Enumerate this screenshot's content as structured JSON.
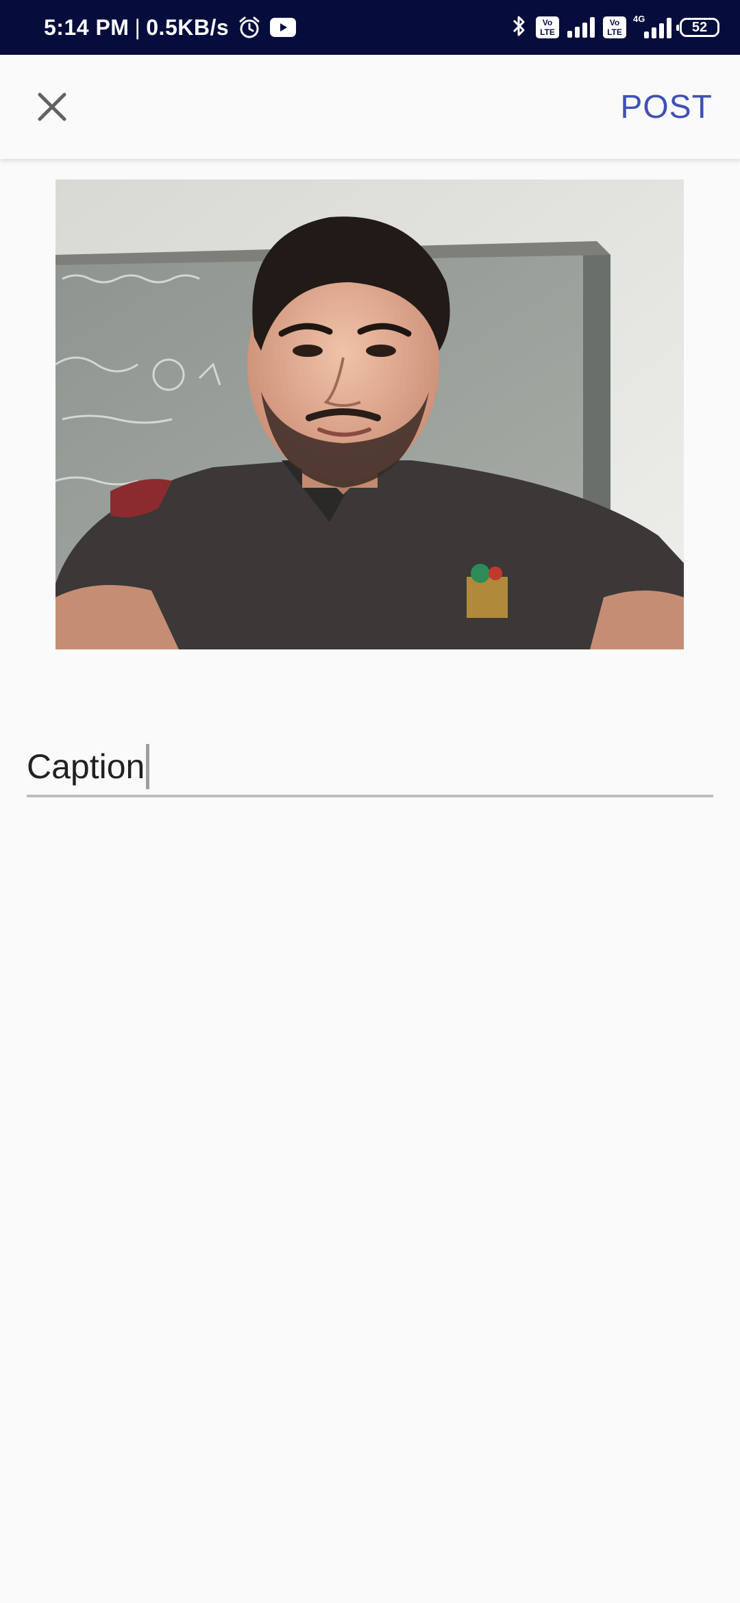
{
  "status_bar": {
    "time": "5:14 PM",
    "separator": "|",
    "net_speed": "0.5KB/s",
    "alarm_icon": "alarm-icon",
    "youtube_icon": "youtube-icon",
    "bluetooth_icon": "bluetooth-icon",
    "volte1_top": "Vo",
    "volte1_bottom": "LTE",
    "volte2_top": "Vo",
    "volte2_bottom": "LTE",
    "network_type": "4G",
    "battery_level": "52",
    "background_color": "#050d3d"
  },
  "app_bar": {
    "close_icon": "close-icon",
    "post_label": "POST",
    "accent_color": "#3f51b5"
  },
  "photo": {
    "icon": "selfie-photo"
  },
  "caption": {
    "placeholder": "Caption",
    "value": ""
  }
}
